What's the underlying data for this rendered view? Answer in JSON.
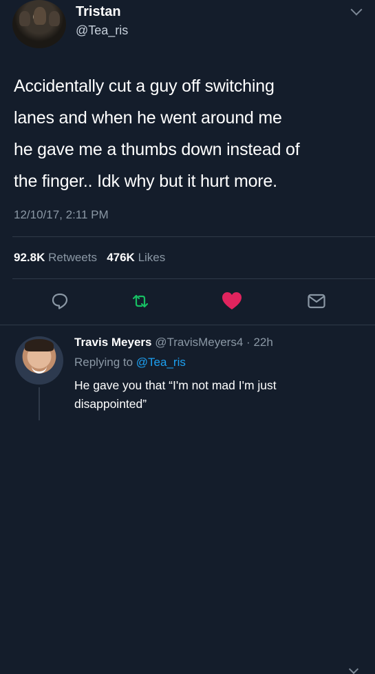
{
  "tweet": {
    "author_name": "Tristan",
    "author_handle": "@Tea_ris",
    "text_lines": [
      "Accidentally cut a guy off switching",
      "lanes and when he went around me",
      "he gave me a thumbs down instead of",
      "the finger.. Idk why but it hurt more."
    ],
    "timestamp": "12/10/17, 2:11 PM",
    "retweets_count": "92.8K",
    "retweets_label": "Retweets",
    "likes_count": "476K",
    "likes_label": "Likes",
    "actions": {
      "reply_icon": "speech-bubble-icon",
      "retweet_icon": "retweet-icon",
      "like_icon": "heart-icon",
      "share_icon": "mail-icon"
    }
  },
  "reply": {
    "author_name": "Travis Meyers",
    "author_handle": "@TravisMeyers4",
    "separator": "·",
    "age": "22h",
    "replying_prefix": "Replying to",
    "replying_to": "@Tea_ris",
    "text_lines": [
      "He gave you that “I'm not mad I'm just",
      "disappointed”"
    ]
  },
  "colors": {
    "background": "#141d2b",
    "text_primary": "#ffffff",
    "text_secondary": "#8b98a5",
    "link": "#1da1f2",
    "retweet": "#17bf63",
    "like": "#e0245e",
    "divider": "#2f3a49"
  }
}
